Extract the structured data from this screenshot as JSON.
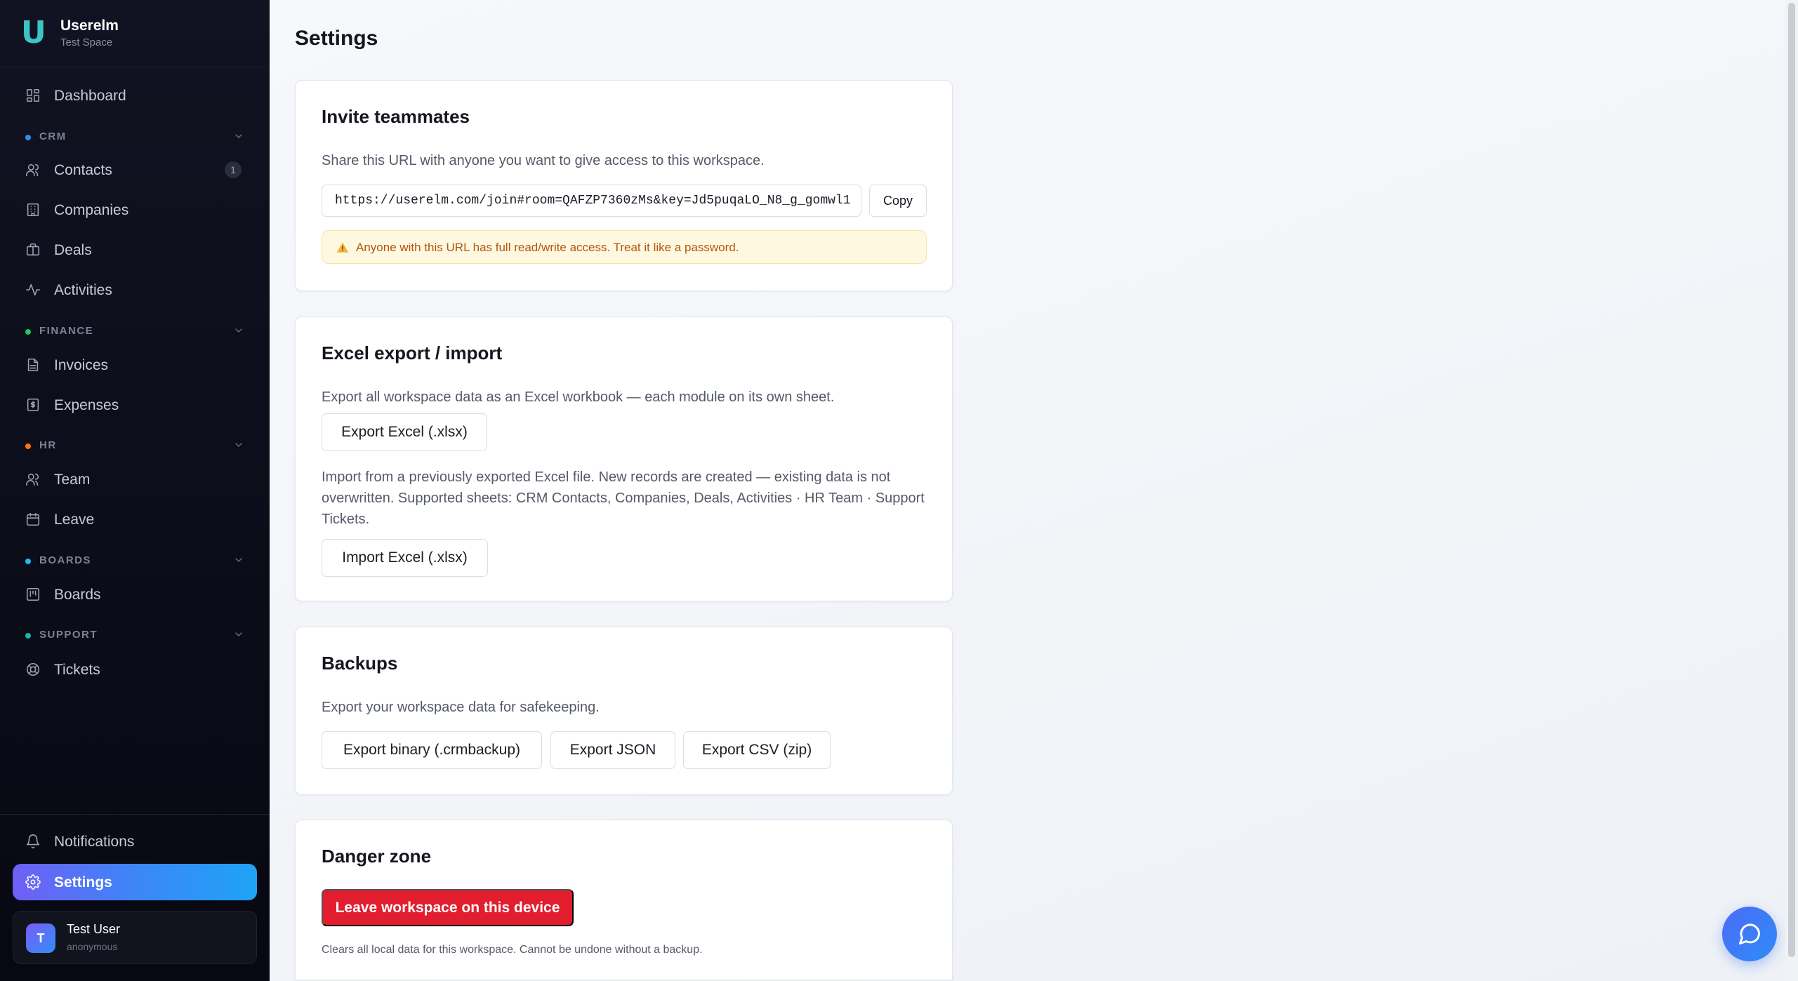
{
  "brand": {
    "name": "Userelm",
    "workspace": "Test Space",
    "logo_letter": "U"
  },
  "sidebar": {
    "dashboard": "Dashboard",
    "sections": {
      "crm": {
        "label": "CRM",
        "color": "#2f8cf7"
      },
      "finance": {
        "label": "FINANCE",
        "color": "#22c55e"
      },
      "hr": {
        "label": "HR",
        "color": "#f97316"
      },
      "boards": {
        "label": "BOARDS",
        "color": "#22b8f0"
      },
      "support": {
        "label": "SUPPORT",
        "color": "#14b8a6"
      }
    },
    "items": {
      "contacts": {
        "label": "Contacts",
        "count": "1"
      },
      "companies": "Companies",
      "deals": "Deals",
      "activities": "Activities",
      "invoices": "Invoices",
      "expenses": "Expenses",
      "team": "Team",
      "leave": "Leave",
      "boards": "Boards",
      "tickets": "Tickets"
    },
    "notifications": "Notifications",
    "settings": "Settings",
    "user": {
      "initial": "T",
      "name": "Test User",
      "sub": "anonymous"
    }
  },
  "page": {
    "title": "Settings"
  },
  "invite": {
    "title": "Invite teammates",
    "description": "Share this URL with anyone you want to give access to this workspace.",
    "url": "https://userelm.com/join#room=QAFZP7360zMs&key=Jd5puqaLO_N8_g_gomwl1",
    "copy_label": "Copy",
    "warning": "Anyone with this URL has full read/write access. Treat it like a password."
  },
  "excel": {
    "title": "Excel export / import",
    "export_description": "Export all workspace data as an Excel workbook — each module on its own sheet.",
    "export_label": "Export Excel (.xlsx)",
    "import_description": "Import from a previously exported Excel file. New records are created — existing data is not overwritten. Supported sheets: CRM Contacts, Companies, Deals, Activities · HR Team · Support Tickets.",
    "import_label": "Import Excel (.xlsx)"
  },
  "backups": {
    "title": "Backups",
    "description": "Export your workspace data for safekeeping.",
    "binary_label": "Export binary (.crmbackup)",
    "json_label": "Export JSON",
    "csv_label": "Export CSV (zip)"
  },
  "danger": {
    "title": "Danger zone",
    "leave_label": "Leave workspace on this device",
    "note": "Clears all local data for this workspace. Cannot be undone without a backup."
  },
  "colors": {
    "accent_gradient_start": "#6f5ff5",
    "accent_gradient_end": "#1ea3f6",
    "danger": "#e11d2e",
    "logo": "#3bc6c4"
  }
}
